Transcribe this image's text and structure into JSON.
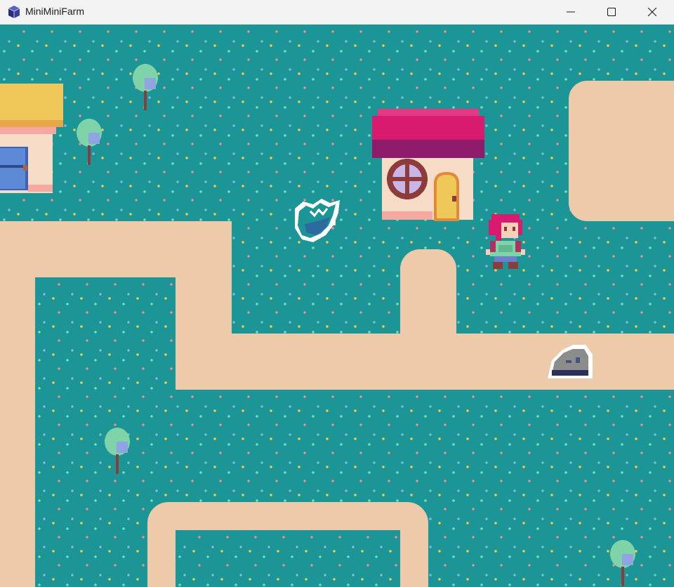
{
  "window": {
    "title": "MiniMiniFarm",
    "icon": "cube-app-icon",
    "controls": [
      "minimize-icon",
      "maximize-icon",
      "close-icon"
    ]
  },
  "scene": {
    "grass_color": "#1b9596",
    "path_color": "#eccaaa",
    "flower_colors": [
      "#f2c94c",
      "#7fdcb0",
      "#ef8e8e",
      "#8fb7e8"
    ],
    "roof_colors": {
      "red_house": "#d81b6e",
      "yellow_house": "#f0c85a"
    },
    "player_hair_color": "#d81b6e",
    "sprites": [
      "house-red-roof",
      "house-yellow-roof",
      "player-character",
      "bird-creature",
      "rock",
      "tree"
    ]
  }
}
